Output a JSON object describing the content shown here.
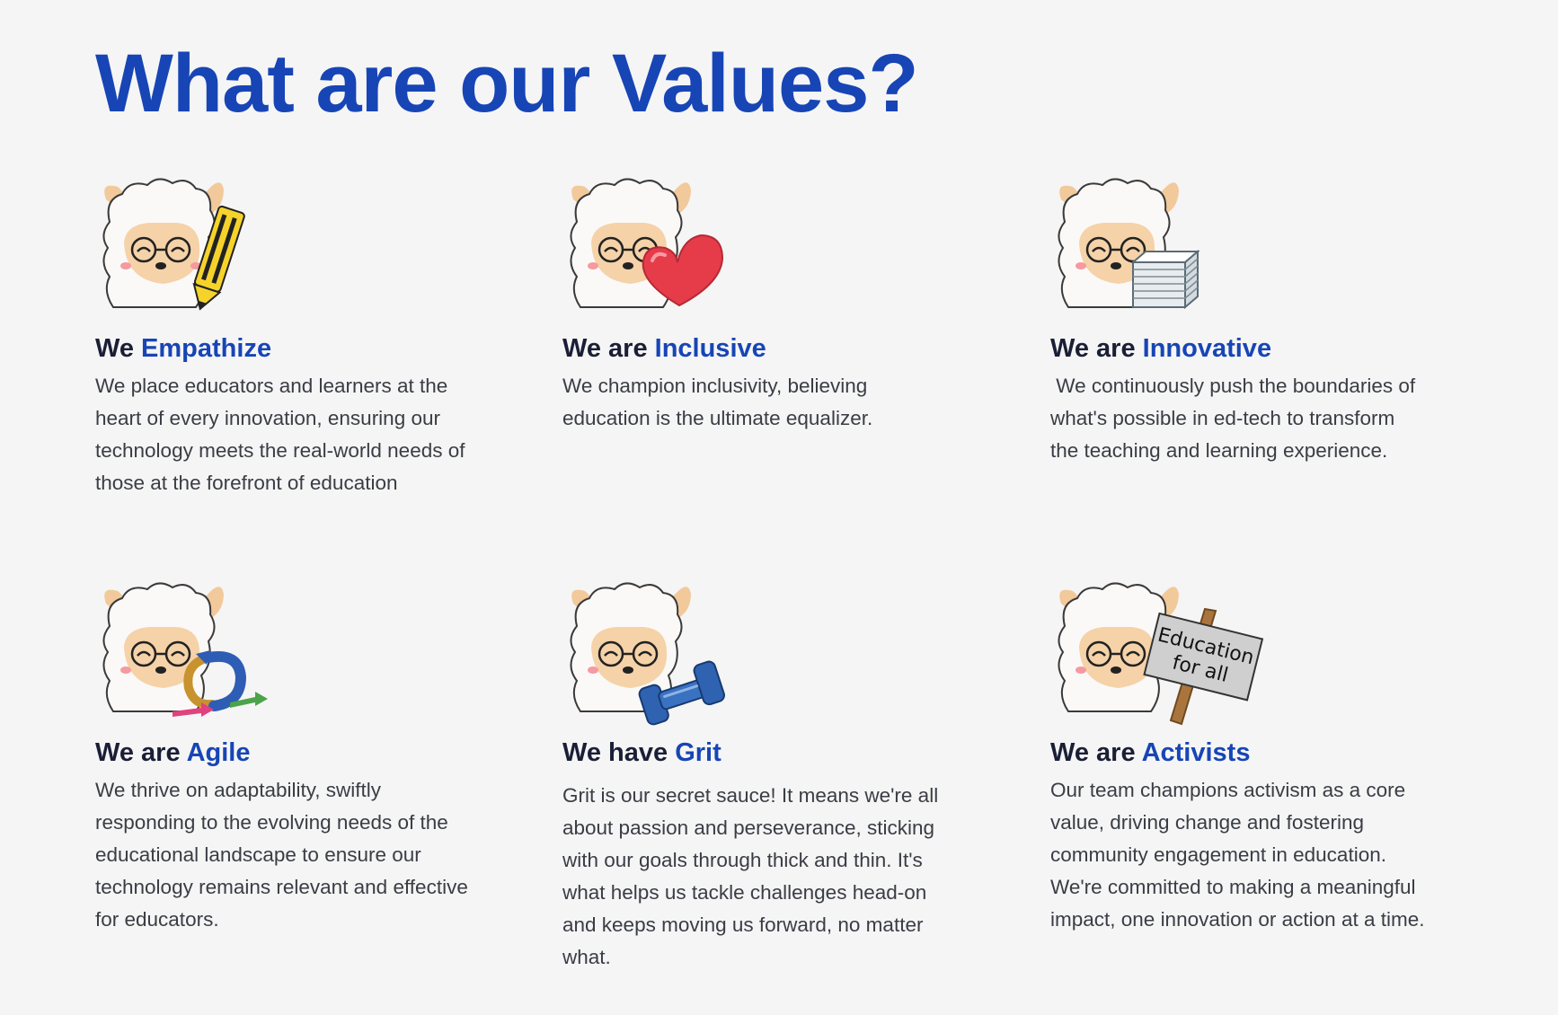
{
  "page": {
    "title": "What are our Values?",
    "title_color": "#1745b5",
    "accent_color": "#1745b5",
    "background": "#f5f5f5"
  },
  "values": [
    {
      "prefix": "We ",
      "highlight": "Empathize",
      "prop_icon": "pencil-icon",
      "body": "We place educators and learners at the heart of every innovation, ensuring our technology meets the real-world needs of those at the forefront of education"
    },
    {
      "prefix": "We are ",
      "highlight": "Inclusive",
      "prop_icon": "heart-icon",
      "body": "We champion inclusivity, believing education is the ultimate equalizer."
    },
    {
      "prefix": "We are ",
      "highlight": "Innovative",
      "prop_icon": "paper-stack-icon",
      "body": " We continuously push the boundaries of what's possible in ed-tech to transform the teaching and learning experience."
    },
    {
      "prefix": "We are ",
      "highlight": "Agile",
      "prop_icon": "arrows-icon",
      "body": "We thrive on adaptability, swiftly responding to the evolving needs of the educational landscape to ensure our technology remains relevant and effective for educators."
    },
    {
      "prefix": "We have ",
      "highlight": "Grit",
      "prop_icon": "dumbbell-icon",
      "body": "Grit is our secret sauce! It means we're all about passion and perseverance, sticking with our goals through thick and thin. It's what helps us tackle challenges head-on and keeps moving us forward, no matter what."
    },
    {
      "prefix": "We are ",
      "highlight": "Activists",
      "prop_icon": "protest-sign-icon",
      "sign_text_line1": "Education",
      "sign_text_line2": "for all",
      "body": "Our team champions activism as a core value, driving change and fostering community engagement in education. We're committed to making a meaningful impact, one innovation or action at a time."
    }
  ]
}
